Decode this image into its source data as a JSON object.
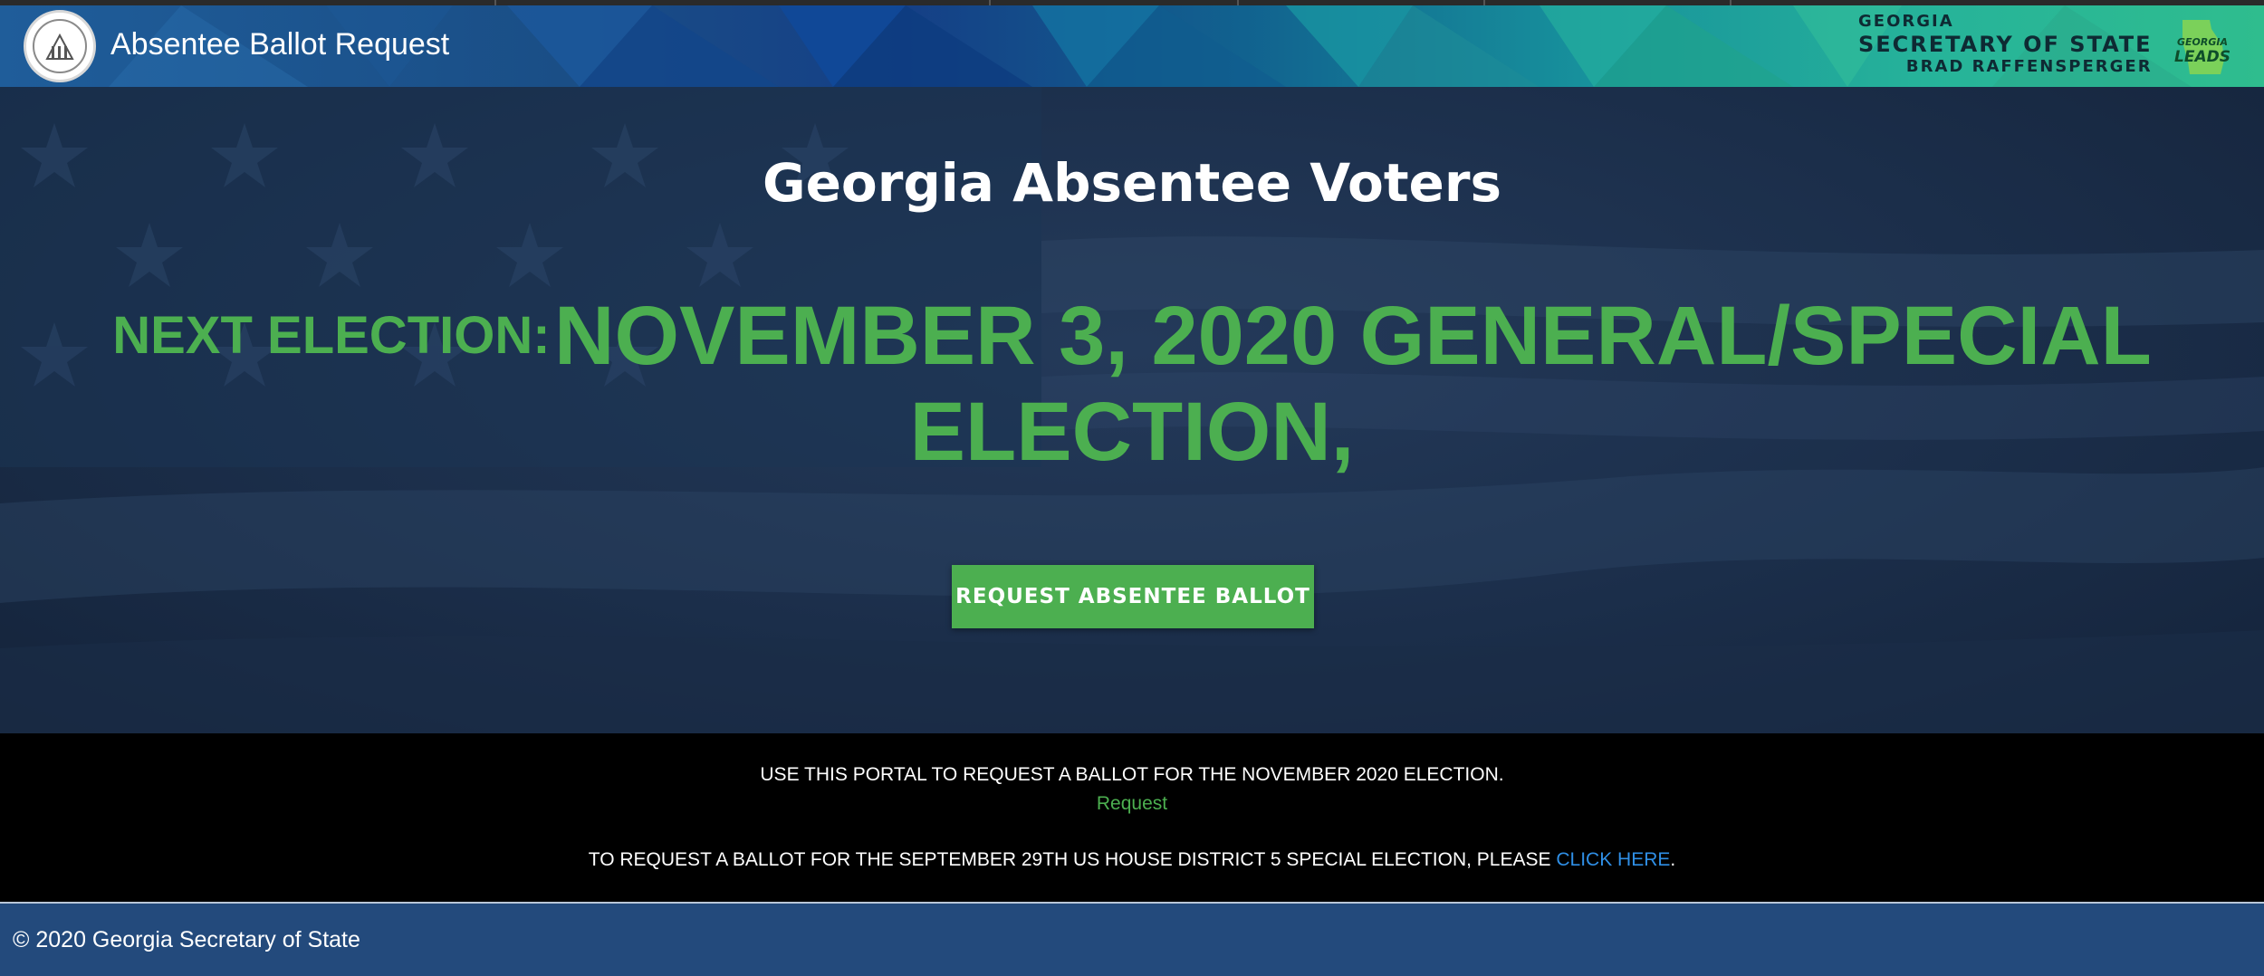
{
  "header": {
    "app_title": "Absentee Ballot Request",
    "sos_line1": "GEORGIA",
    "sos_line2": "SECRETARY OF STATE",
    "sos_line3": "BRAD RAFFENSPERGER",
    "logo_alt_text": "GEORGIA LEADS"
  },
  "hero": {
    "title": "Georgia Absentee Voters",
    "next_election_prefix": "NEXT ELECTION:",
    "next_election_name": "NOVEMBER 3, 2020 GENERAL/SPECIAL ELECTION,",
    "button_label": "REQUEST ABSENTEE BALLOT"
  },
  "info": {
    "line1": "USE THIS PORTAL TO REQUEST A BALLOT FOR THE NOVEMBER 2020 ELECTION.",
    "request_link": "Request",
    "line2_text": "TO REQUEST A BALLOT FOR THE SEPTEMBER 29TH US HOUSE DISTRICT 5 SPECIAL ELECTION, PLEASE ",
    "line2_link": "CLICK HERE",
    "line2_end": "."
  },
  "footer": {
    "copyright": "© 2020 Georgia Secretary of State"
  },
  "colors": {
    "accent_green": "#4caf50",
    "link_blue": "#2f8fe6",
    "footer_blue": "#234a7c"
  },
  "icons": {
    "seal": "georgia-seal-icon",
    "leads": "georgia-leads-logo"
  }
}
